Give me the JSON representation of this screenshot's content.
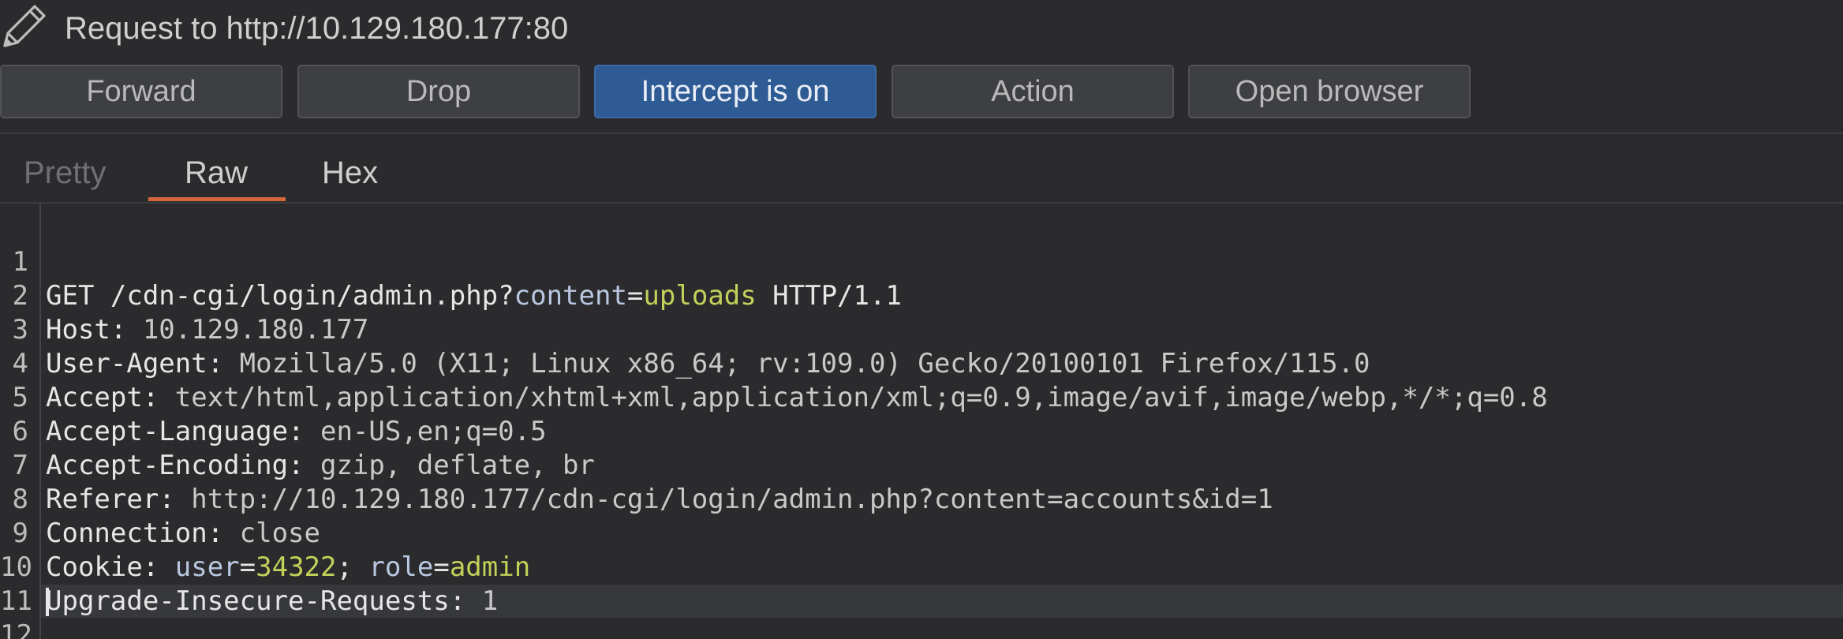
{
  "header": {
    "title": "Request to http://10.129.180.177:80",
    "icon": "pencil-icon"
  },
  "toolbar": {
    "forward_label": "Forward",
    "drop_label": "Drop",
    "intercept_label": "Intercept is on",
    "action_label": "Action",
    "open_browser_label": "Open browser"
  },
  "tabs": {
    "pretty": "Pretty",
    "raw": "Raw",
    "hex": "Hex",
    "active": "Raw"
  },
  "colors": {
    "accent_tab": "#d4683a",
    "intercept_button": "#2f5b95",
    "param_value": "#c3d15a",
    "param_name": "#b8c7e0"
  },
  "request": {
    "line_numbers": [
      "1",
      "2",
      "3",
      "4",
      "5",
      "6",
      "7",
      "8",
      "9",
      "10",
      "11",
      "12"
    ],
    "l1": {
      "method_path": "GET /cdn-cgi/login/admin.php?",
      "param_name": "content",
      "eq": "=",
      "param_value": "uploads",
      "version": " HTTP/1.1"
    },
    "l2": {
      "name": "Host:",
      "value": " 10.129.180.177"
    },
    "l3": {
      "name": "User-Agent:",
      "value": " Mozilla/5.0 (X11; Linux x86_64; rv:109.0) Gecko/20100101 Firefox/115.0"
    },
    "l4": {
      "name": "Accept:",
      "value": " text/html,application/xhtml+xml,application/xml;q=0.9,image/avif,image/webp,*/*;q=0.8"
    },
    "l5": {
      "name": "Accept-Language:",
      "value": " en-US,en;q=0.5"
    },
    "l6": {
      "name": "Accept-Encoding:",
      "value": " gzip, deflate, br"
    },
    "l7": {
      "name": "Referer:",
      "value": " http://10.129.180.177/cdn-cgi/login/admin.php?content=accounts&id=1"
    },
    "l8": {
      "name": "Connection:",
      "value": " close"
    },
    "l9": {
      "name": "Cookie:",
      "c1_name": " user",
      "c1_eq": "=",
      "c1_value": "34322",
      "sep": ";",
      "c2_name": " role",
      "c2_eq": "=",
      "c2_value": "admin"
    },
    "l10": {
      "name": "Upgrade-Insecure-Requests:",
      "value": " 1"
    }
  }
}
